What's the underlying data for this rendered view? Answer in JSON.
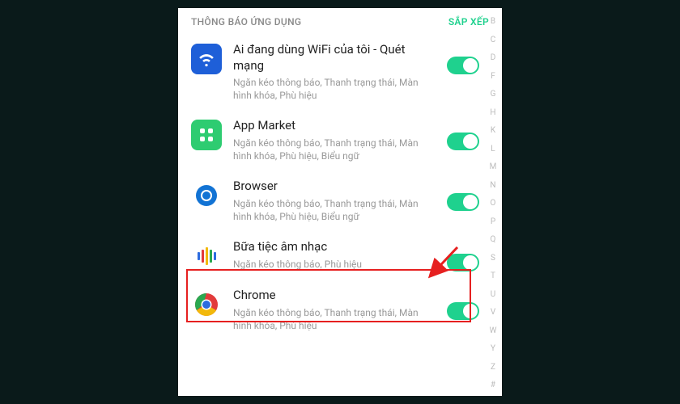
{
  "header": {
    "title": "THÔNG BÁO ỨNG DỤNG",
    "sort_label": "SẮP XẾP"
  },
  "apps": [
    {
      "name": "Ai đang dùng WiFi của tôi - Quét mạng",
      "desc": "Ngăn kéo thông báo, Thanh trạng thái, Màn hình khóa, Phù hiệu",
      "icon": "wifi-icon",
      "toggle": true
    },
    {
      "name": "App Market",
      "desc": "Ngăn kéo thông báo, Thanh trạng thái, Màn hình khóa, Phù hiệu, Biểu ngữ",
      "icon": "market-icon",
      "toggle": true
    },
    {
      "name": "Browser",
      "desc": "Ngăn kéo thông báo, Thanh trạng thái, Màn hình khóa, Phù hiệu, Biểu ngữ",
      "icon": "browser-icon",
      "toggle": true
    },
    {
      "name": "Bữa tiệc âm nhạc",
      "desc": "Ngăn kéo thông báo, Phù hiệu",
      "icon": "music-icon",
      "toggle": true
    },
    {
      "name": "Chrome",
      "desc": "Ngăn kéo thông báo, Thanh trạng thái, Màn hình khóa, Phù hiệu",
      "icon": "chrome-icon",
      "toggle": true
    }
  ],
  "alpha_index": [
    "B",
    "C",
    "D",
    "F",
    "G",
    "H",
    "K",
    "L",
    "M",
    "N",
    "O",
    "P",
    "Q",
    "S",
    "T",
    "U",
    "V",
    "W",
    "Y",
    "Z",
    "#"
  ],
  "colors": {
    "accent": "#1fd18e",
    "highlight": "#e62020"
  }
}
